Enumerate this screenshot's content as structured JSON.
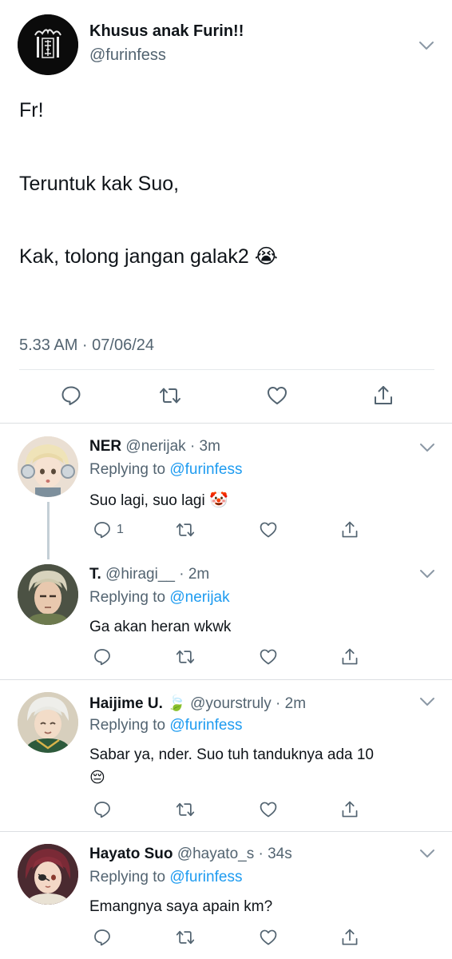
{
  "main_tweet": {
    "author_name": "Khusus anak Furin!!",
    "author_handle": "@furinfess",
    "text_lines": [
      "Fr!",
      "Teruntuk kak Suo,",
      "Kak, tolong jangan galak2"
    ],
    "emoji": "😭",
    "timestamp": "5.33 AM · 07/06/24",
    "actions": [
      "reply-icon",
      "retweet-icon",
      "like-icon",
      "share-icon"
    ]
  },
  "replies": [
    {
      "name": "NER",
      "handle": "@nerijak · 3m",
      "replying_prefix": "Replying to ",
      "replying_to": "@furinfess",
      "text": "Suo lagi, suo lagi",
      "emoji": "🤡",
      "reply_count": "1",
      "avatar_color": "#e8dccf"
    },
    {
      "name": "T.",
      "handle": "@hiragi__ · 2m",
      "replying_prefix": "Replying to ",
      "replying_to": "@nerijak",
      "text": "Ga akan heran wkwk",
      "emoji": "",
      "reply_count": "",
      "avatar_color": "#5c6650"
    },
    {
      "name": "Haijime U.",
      "name_emoji": "🍃",
      "handle": "@yourstruly · 2m",
      "replying_prefix": "Replying to ",
      "replying_to": "@furinfess",
      "text": "Sabar ya, nder. Suo tuh tanduknya ada 10",
      "text_line2_emoji": "😔",
      "reply_count": "",
      "avatar_color": "#d9d3c4"
    },
    {
      "name": "Hayato Suo",
      "handle": "@hayato_s · 34s",
      "replying_prefix": "Replying to ",
      "replying_to": "@furinfess",
      "text": "Emangnya saya apain km?",
      "emoji": "",
      "reply_count": "",
      "avatar_color": "#6a2c33"
    }
  ]
}
